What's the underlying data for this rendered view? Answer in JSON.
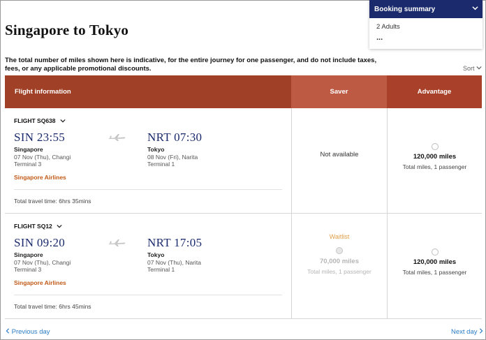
{
  "page": {
    "title": "Singapore to Tokyo"
  },
  "booking_summary": {
    "label": "Booking summary",
    "passengers": "2 Adults",
    "more": "..."
  },
  "disclaimer": "The total number of miles shown here is indicative, for the entire journey for one passenger, and do not include taxes, fees, or any applicable promotional discounts.",
  "sort_label": "Sort",
  "table": {
    "headers": {
      "flight": "Flight information",
      "saver": "Saver",
      "advantage": "Advantage"
    }
  },
  "flights": [
    {
      "number": "FLIGHT SQ638",
      "dep_time": "SIN 23:55",
      "dep_city": "Singapore",
      "dep_date": "07 Nov (Thu), Changi",
      "dep_terminal": "Terminal 3",
      "arr_time": "NRT 07:30",
      "arr_city": "Tokyo",
      "arr_date": "08 Nov (Fri), Narita",
      "arr_terminal": "Terminal 1",
      "airline": "Singapore Airlines",
      "travel_time": "Total travel time: 6hrs 35mins",
      "saver": {
        "status": "Not available"
      },
      "advantage": {
        "miles": "120,000 miles",
        "note": "Total miles, 1 passenger"
      }
    },
    {
      "number": "FLIGHT SQ12",
      "dep_time": "SIN 09:20",
      "dep_city": "Singapore",
      "dep_date": "07 Nov (Thu), Changi",
      "dep_terminal": "Terminal 3",
      "arr_time": "NRT 17:05",
      "arr_city": "Tokyo",
      "arr_date": "07 Nov (Thu), Narita",
      "arr_terminal": "Terminal 1",
      "airline": "Singapore Airlines",
      "travel_time": "Total travel time: 6hrs 45mins",
      "saver": {
        "status": "Waitlist",
        "miles": "70,000 miles",
        "note": "Total miles, 1 passenger"
      },
      "advantage": {
        "miles": "120,000 miles",
        "note": "Total miles, 1 passenger"
      }
    }
  ],
  "nav": {
    "prev": "Previous day",
    "next": "Next day"
  },
  "colors": {
    "header_flight": "#a04027",
    "header_saver": "#bd5a44",
    "header_advantage": "#a8402a",
    "summary_bg": "#1a2a6c",
    "time_text": "#1a2a6c",
    "airline_text": "#c25a18",
    "waitlist_text": "#e0a04a",
    "link": "#2b7cc4"
  },
  "icons": [
    "chevron-down-icon",
    "airplane-icon",
    "chevron-left-icon",
    "chevron-right-icon",
    "radio-button"
  ]
}
